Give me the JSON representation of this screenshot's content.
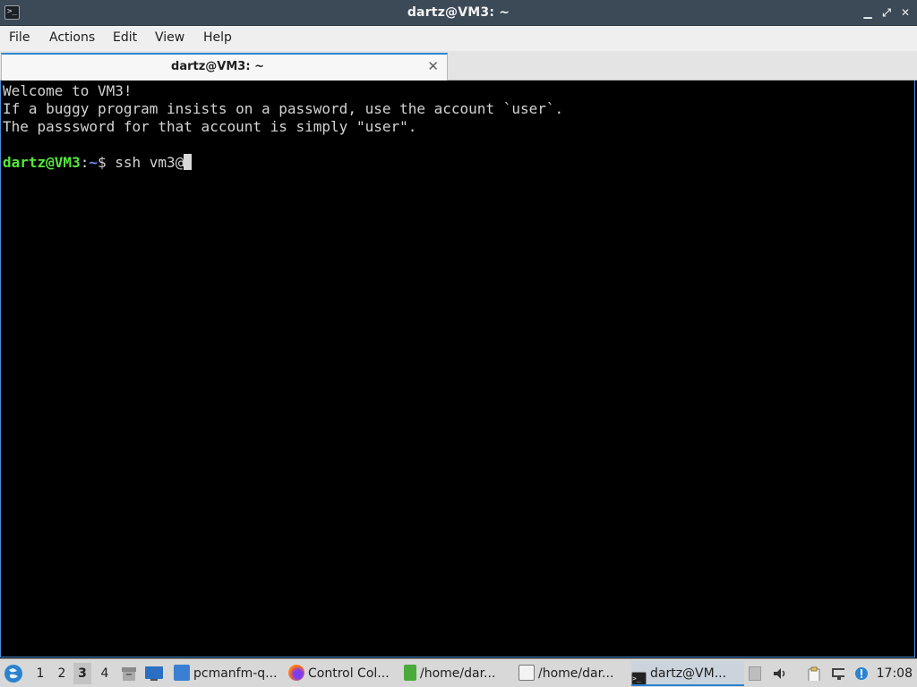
{
  "window": {
    "title": "dartz@VM3: ~",
    "app_icon": ">_",
    "minimize_glyph": "▁",
    "restore_glyph": "⤢",
    "close_glyph": "✕"
  },
  "menu": {
    "items": [
      "File",
      "Actions",
      "Edit",
      "View",
      "Help"
    ]
  },
  "tabs": [
    {
      "label": "dartz@VM3: ~",
      "close_glyph": "✕"
    }
  ],
  "terminal": {
    "lines": [
      "Welcome to VM3!",
      "If a buggy program insists on a password, use the account `user`.",
      "The passsword for that account is simply \"user\".",
      ""
    ],
    "prompt": {
      "user_host": "dartz@VM3",
      "separator": ":",
      "path": "~",
      "symbol": "$",
      "command": " ssh vm3@"
    }
  },
  "taskbar": {
    "desktops": [
      "1",
      "2",
      "3",
      "4"
    ],
    "active_desktop": "3",
    "tasks": [
      {
        "label": "pcmanfm-q...",
        "icon": "folder-icon"
      },
      {
        "label": "Control Col...",
        "icon": "firefox-icon"
      },
      {
        "label": "/home/dar...",
        "icon": "text-file-icon"
      },
      {
        "label": "/home/dar...",
        "icon": "feather-editor-icon"
      },
      {
        "label": "dartz@VM...",
        "icon": "terminal-icon",
        "active": true
      }
    ],
    "clock": "17:08"
  },
  "colors": {
    "titlebar": "#3c4957",
    "accent": "#2b83cf",
    "prompt_user": "#55e63a",
    "prompt_path": "#6b8ff5",
    "terminal_bg": "#000000"
  }
}
